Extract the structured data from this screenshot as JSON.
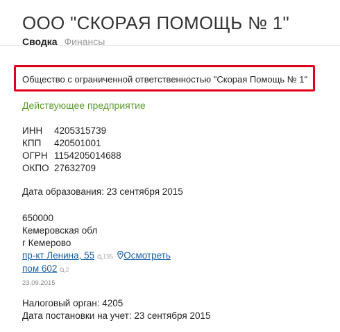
{
  "header": {
    "title": "ООО \"СКОРАЯ ПОМОЩЬ № 1\"",
    "tabs": [
      {
        "label": "Сводка"
      },
      {
        "label": "Финансы"
      }
    ]
  },
  "company": {
    "full_name": "Общество с ограниченной ответственностью \"Скорая Помощь № 1\"",
    "status": "Действующее предприятие",
    "codes": [
      {
        "label": "ИНН",
        "value": "4205315739"
      },
      {
        "label": "КПП",
        "value": "420501001"
      },
      {
        "label": "ОГРН",
        "value": "1154205014688"
      },
      {
        "label": "ОКПО",
        "value": "27632709"
      }
    ],
    "founded": "Дата образования: 23 сентября 2015"
  },
  "address": {
    "postcode": "650000",
    "region": "Кемеровская обл",
    "city": "г Кемерово",
    "street": "пр-кт Ленина, 55",
    "street_count": "195",
    "map_link": "Осмотреть",
    "room": "пом 602",
    "room_count": "2",
    "date": "23.09.2015"
  },
  "tax": {
    "authority": "Налоговый орган: 4205",
    "registered": "Дата постановки на учет: 23 сентября 2015"
  },
  "colors": {
    "highlight_border": "#e0001b",
    "status_green": "#5a9b2f",
    "link_blue": "#1a5fa6"
  }
}
